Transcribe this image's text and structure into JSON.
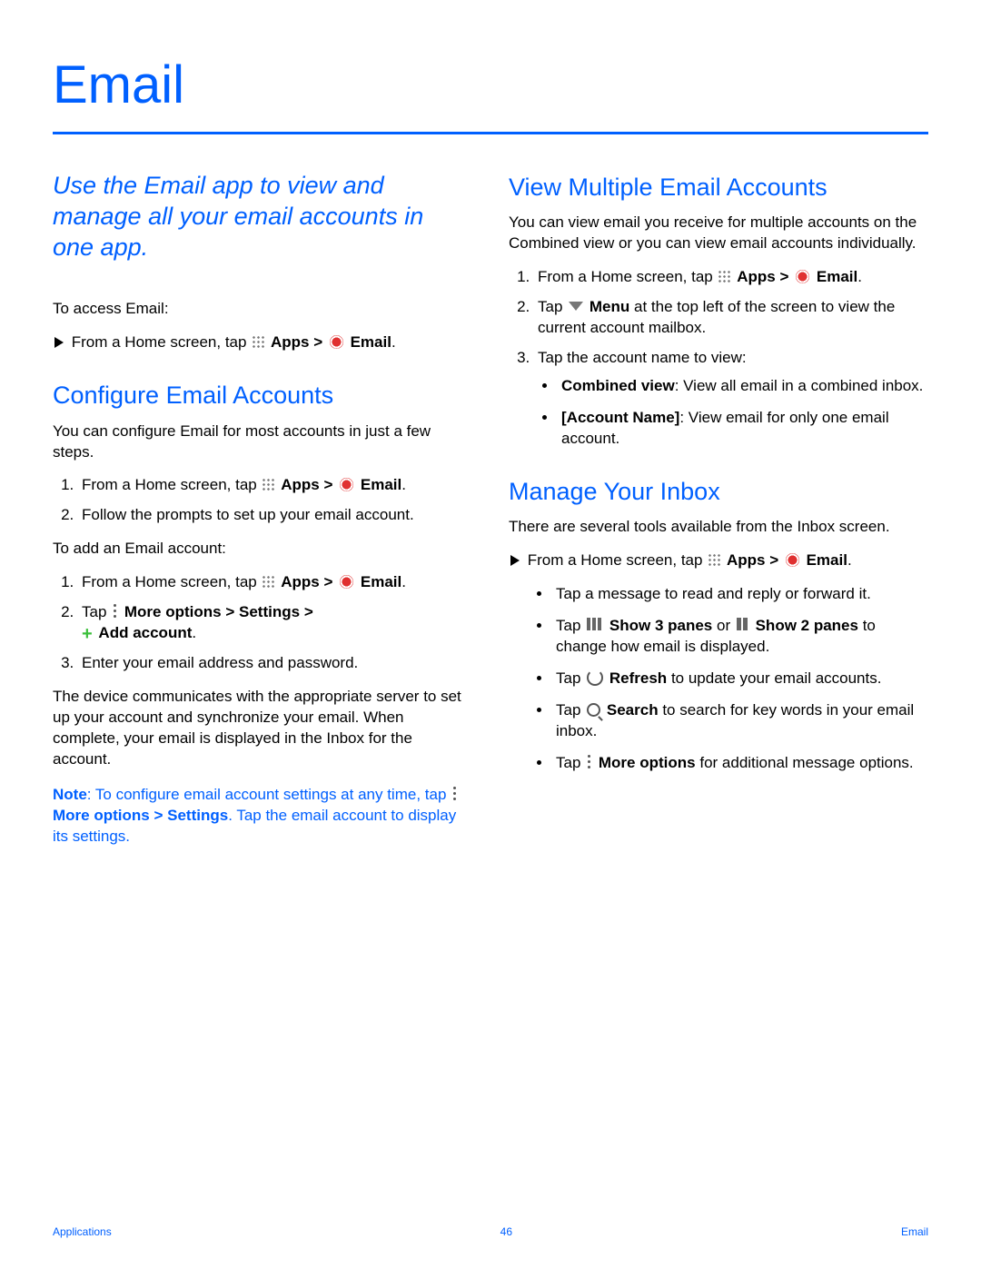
{
  "title": "Email",
  "intro": "Use the Email app to view and manage all your email accounts in one app.",
  "to_access": "To access Email:",
  "from_home_tap": "From a Home screen, tap",
  "apps": "Apps",
  "gt": ">",
  "email": "Email",
  "period": ".",
  "s1": {
    "heading": "Configure Email Accounts",
    "p1": "You can configure Email for most accounts in just a few steps.",
    "li2": "Follow the prompts to set up your email account.",
    "to_add": "To add an Email account:",
    "tap": "Tap",
    "more_options": "More options",
    "settings": "Settings",
    "add_account": "Add account",
    "li3": "Enter your email address and password.",
    "p_after": "The device communicates with the appropriate server to set up your account and synchronize your email. When complete, your email is displayed in the Inbox for the account.",
    "note_label": "Note",
    "note_1": ": To configure email account settings at any time, tap",
    "note_2": ". Tap the email account to display its settings."
  },
  "s2": {
    "heading": "View Multiple Email Accounts",
    "p1": "You can view email you receive for multiple accounts on the Combined view or you can view email accounts individually.",
    "li2a": "Tap",
    "menu": "Menu",
    "li2b": "at the top left of the screen to view the current account mailbox.",
    "li3": "Tap the account name to view:",
    "b_cv": "Combined view",
    "b_cv_desc": ": View all email in a combined inbox.",
    "b_an": "[Account Name]",
    "b_an_desc": ": View email for only one email account."
  },
  "s3": {
    "heading": "Manage Your Inbox",
    "p1": "There are several tools available from the Inbox screen.",
    "b1": "Tap a message to read and reply or forward it.",
    "b2a": "Tap",
    "show3": "Show 3 panes",
    "or": "or",
    "show2": "Show 2 panes",
    "b2b": "to change how email is displayed.",
    "b3a": "Tap",
    "refresh": "Refresh",
    "b3b": "to update your email accounts.",
    "b4a": "Tap",
    "search": "Search",
    "b4b": "to search for key words in your email inbox.",
    "b5a": "Tap",
    "more_options": "More options",
    "b5b": "for additional message options."
  },
  "footer": {
    "left": "Applications",
    "center": "46",
    "right": "Email"
  }
}
